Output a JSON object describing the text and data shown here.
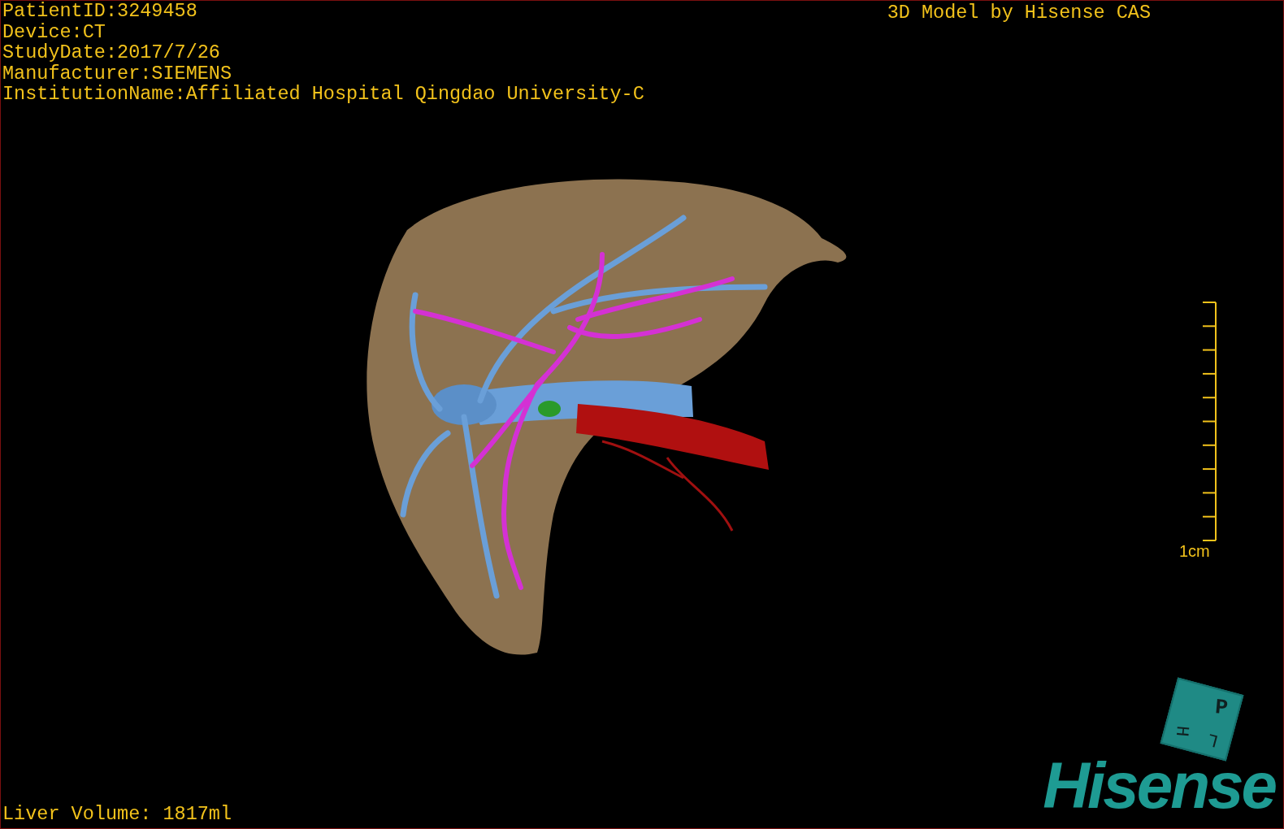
{
  "patient_info": [
    "PatientID:3249458",
    "Device:CT",
    "StudyDate:2017/7/26",
    "Manufacturer:SIEMENS",
    "InstitutionName:Affiliated Hospital Qingdao University-C"
  ],
  "header_right": "3D Model by Hisense CAS",
  "scale_bar": {
    "label": "1cm"
  },
  "orientation_cube": {
    "faces": [
      "P",
      "H",
      "L"
    ]
  },
  "logo": "Hisense",
  "footer": "Liver Volume: 1817ml"
}
